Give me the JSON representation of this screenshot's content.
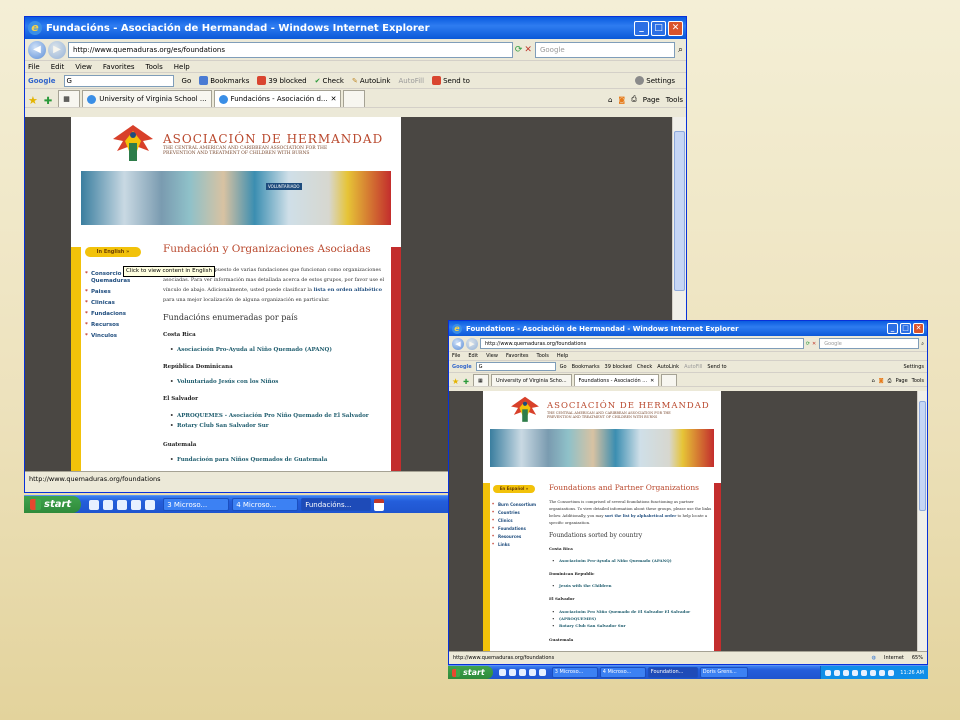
{
  "big": {
    "title": "Fundacións - Asociación de Hermandad - Windows Internet Explorer",
    "url": "http://www.quemaduras.org/es/foundations",
    "search_placeholder": "Google",
    "menu": [
      "File",
      "Edit",
      "View",
      "Favorites",
      "Tools",
      "Help"
    ],
    "toolbar": {
      "google": "Google",
      "google_input": "G",
      "go": "Go",
      "bookmarks": "Bookmarks",
      "blocked": "39 blocked",
      "check": "Check",
      "autolink": "AutoLink",
      "autofill": "AutoFill",
      "sendto": "Send to",
      "settings": "Settings"
    },
    "tabs": [
      "University of Virginia School ...",
      "Fundacións - Asociación d..."
    ],
    "cmd": {
      "page": "Page",
      "tools": "Tools"
    },
    "site": {
      "org_name": "ASOCIACIÓN DE HERMANDAD",
      "org_sub1": "THE CENTRAL AMERICAN AND CARIBBEAN ASSOCIATION FOR THE",
      "org_sub2": "PREVENTION AND TREATMENT OF CHILDREN WITH BURNS",
      "sign": "VOLUNTARIADO",
      "lang_button": "In English »",
      "tooltip": "Click to view content in English",
      "nav": [
        "Consorcio de Quemaduras",
        "Paises",
        "Clinicas",
        "Fundacions",
        "Recursos",
        "Vinculos"
      ],
      "heading": "Fundación y Organizaciones Asociadas",
      "intro_1": "El Consorcio es compuesto de varias fundaciones que funcionan como organizaciones",
      "intro_2": "asociadas. Para ver información mas detallada acerca de estos grupos, por favor use el",
      "intro_3": "vínculo de abajo. Adicionalmente, usted puede clasificar la",
      "intro_link_1": "lista en orden",
      "intro_link_2": "alfabético",
      "intro_4": "para una mejor localización de alguna organización en particular.",
      "sub_heading": "Fundacións enumeradas por país",
      "countries": [
        {
          "name": "Costa Rica",
          "orgs": [
            "Asociacio&#243;n Pro-Ayuda al Niño Quemado (APANQ)"
          ]
        },
        {
          "name": "República Dominicana",
          "orgs": [
            "Voluntariado Jesús con los Niños"
          ]
        },
        {
          "name": "El Salvador",
          "orgs": [
            "APROQUEMES - Asociación Pro Niño Quemado de El Salvador",
            "Rotary Club San Salvador Sur"
          ]
        },
        {
          "name": "Guatemala",
          "orgs": [
            "Fundacio&#243;n para Niños Quemados de Guatemala"
          ]
        }
      ]
    },
    "status": "http://www.quemaduras.org/foundations"
  },
  "small": {
    "title": "Foundations - Asociación de Hermandad - Windows Internet Explorer",
    "url": "http://www.quemaduras.org/foundations",
    "search_placeholder": "Google",
    "menu": [
      "File",
      "Edit",
      "View",
      "Favorites",
      "Tools",
      "Help"
    ],
    "toolbar": {
      "google": "Google",
      "google_input": "G",
      "go": "Go",
      "bookmarks": "Bookmarks",
      "blocked": "39 blocked",
      "check": "Check",
      "autolink": "AutoLink",
      "autofill": "AutoFill",
      "sendto": "Send to",
      "settings": "Settings"
    },
    "tabs": [
      "University of Virginia Scho...",
      "Foundations - Asociación ..."
    ],
    "cmd": {
      "page": "Page",
      "tools": "Tools"
    },
    "site": {
      "org_name": "ASOCIACIÓN DE HERMANDAD",
      "org_sub1": "THE CENTRAL AMERICAN AND CARIBBEAN ASSOCIATION FOR THE",
      "org_sub2": "PREVENTION AND TREATMENT OF CHILDREN WITH BURNS",
      "lang_button": "En Español »",
      "nav": [
        "Burn Consortium",
        "Countries",
        "Clinics",
        "Foundations",
        "Resources",
        "Links"
      ],
      "heading": "Foundations and Partner Organizations",
      "intro_1": "The Consortium is comprised of several foundations functioning as partner",
      "intro_2": "organizations. To view detailed information about these groups, please use the links",
      "intro_3": "below. Additionally, you may",
      "intro_link": "sort the list by alphabetical order",
      "intro_4": "to help locate a",
      "intro_5": "specific organization.",
      "sub_heading": "Foundations sorted by country",
      "countries": [
        {
          "name": "Costa Rica",
          "orgs": [
            "Asociacio&#243;n Pro-Ayuda al Niño Quemado (APANQ)"
          ]
        },
        {
          "name": "Dominican Republic",
          "orgs": [
            "Jesús with the Children"
          ]
        },
        {
          "name": "El Salvador",
          "orgs": [
            "Asociacio&#243;n Pro Niño Quemado de El Salvador El Salvador",
            "(APROQUEMES)",
            "Rotary Club San Salvador Sur"
          ]
        },
        {
          "name": "Guatemala",
          "orgs": []
        }
      ]
    },
    "status": "http://www.quemaduras.org/foundations",
    "zone": "Internet",
    "zoom": "65%"
  },
  "taskbar_big": {
    "start": "start",
    "tasks": [
      "3 Microso...",
      "4 Microso...",
      "Fundacións..."
    ]
  },
  "taskbar_small": {
    "start": "start",
    "tasks": [
      "3 Microso...",
      "4 Microso...",
      "Foundation...",
      "Doris Grens..."
    ],
    "clock": "11:26 AM"
  },
  "colors": {
    "xp_blue": "#0a5be0",
    "brand_red": "#b9482d",
    "stripe_yellow": "#f2c20a",
    "link_blue": "#1e4c7d"
  }
}
